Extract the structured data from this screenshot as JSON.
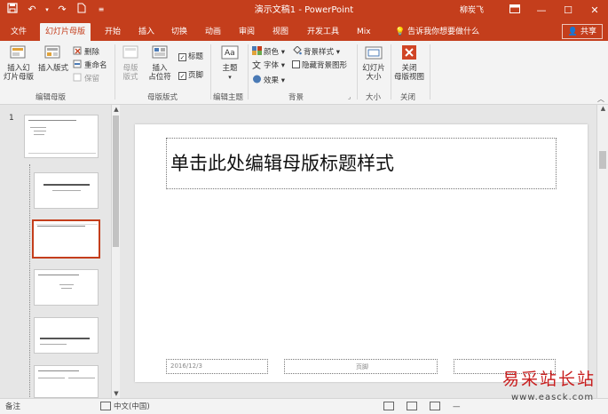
{
  "window": {
    "title": "演示文稿1  -  PowerPoint",
    "user": "柳炭飞"
  },
  "quick_access": [
    "save-icon",
    "undo-icon",
    "redo-icon",
    "new-file-icon",
    "customize-icon"
  ],
  "tabs": [
    {
      "label": "文件",
      "active": false
    },
    {
      "label": "幻灯片母版",
      "active": true
    },
    {
      "label": "开始",
      "active": false
    },
    {
      "label": "插入",
      "active": false
    },
    {
      "label": "切换",
      "active": false
    },
    {
      "label": "动画",
      "active": false
    },
    {
      "label": "审阅",
      "active": false
    },
    {
      "label": "视图",
      "active": false
    },
    {
      "label": "开发工具",
      "active": false
    },
    {
      "label": "Mix",
      "active": false
    }
  ],
  "tellme": "告诉我你想要做什么",
  "share": "共享",
  "ribbon": {
    "edit_master": {
      "label": "编辑母版",
      "insert_master": "插入幻\n灯片母版",
      "insert_layout": "插入版式",
      "delete": "删除",
      "rename": "重命名",
      "preserve": "保留"
    },
    "master_layout": {
      "label": "母版版式",
      "master_layout_btn": "母版\n版式",
      "insert_placeholder": "插入\n占位符",
      "title_chk": "标题",
      "footer_chk": "页脚"
    },
    "edit_theme": {
      "label": "编辑主题",
      "theme": "主题"
    },
    "background": {
      "label": "背景",
      "colors": "颜色",
      "fonts": "字体",
      "effects": "效果",
      "bg_styles": "背景样式",
      "hide_bg": "隐藏背景图形"
    },
    "size": {
      "label": "大小",
      "slide_size": "幻灯片\n大小"
    },
    "close": {
      "label": "关闭",
      "close_master": "关闭\n母版视图"
    }
  },
  "thumbnails": {
    "first_number": "1"
  },
  "slide": {
    "title": "单击此处编辑母版标题样式",
    "date": "2016/12/3",
    "footer": "页脚"
  },
  "status": {
    "notes": "备注",
    "language": "中文(中国)"
  },
  "watermark": {
    "text_cn": "易采站长站",
    "text_en": "www.easck.com"
  },
  "colors": {
    "accent": "#c43e1c",
    "selected_border": "#c43e1c"
  }
}
